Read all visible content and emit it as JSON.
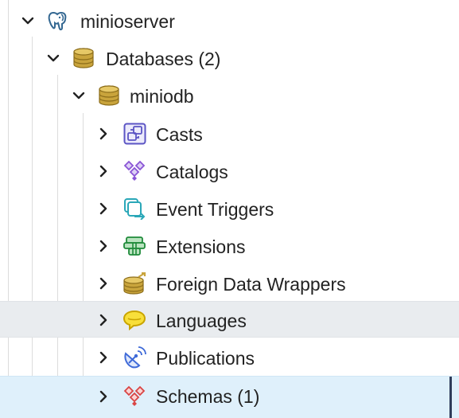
{
  "tree": {
    "server": {
      "label": "minioserver",
      "icon": "postgres-elephant-icon",
      "expanded": true
    },
    "databases": {
      "label": "Databases (2)",
      "icon": "database-stack-icon",
      "expanded": true
    },
    "database": {
      "label": "miniodb",
      "icon": "database-stack-icon",
      "expanded": true
    },
    "children": [
      {
        "label": "Casts",
        "icon": "cast-icon",
        "expanded": false
      },
      {
        "label": "Catalogs",
        "icon": "catalog-icon",
        "expanded": false
      },
      {
        "label": "Event Triggers",
        "icon": "event-trigger-icon",
        "expanded": false
      },
      {
        "label": "Extensions",
        "icon": "extension-icon",
        "expanded": false
      },
      {
        "label": "Foreign Data Wrappers",
        "icon": "foreign-data-wrapper-icon",
        "expanded": false
      },
      {
        "label": "Languages",
        "icon": "language-icon",
        "expanded": false,
        "state": "hover"
      },
      {
        "label": "Publications",
        "icon": "publication-icon",
        "expanded": false
      },
      {
        "label": "Schemas (1)",
        "icon": "schema-icon",
        "expanded": false,
        "state": "selected"
      }
    ]
  },
  "colors": {
    "hover_row": "#e9ecef",
    "selected_row": "#dff0fb",
    "selected_marker": "#2f3d5b",
    "text": "#222222"
  }
}
